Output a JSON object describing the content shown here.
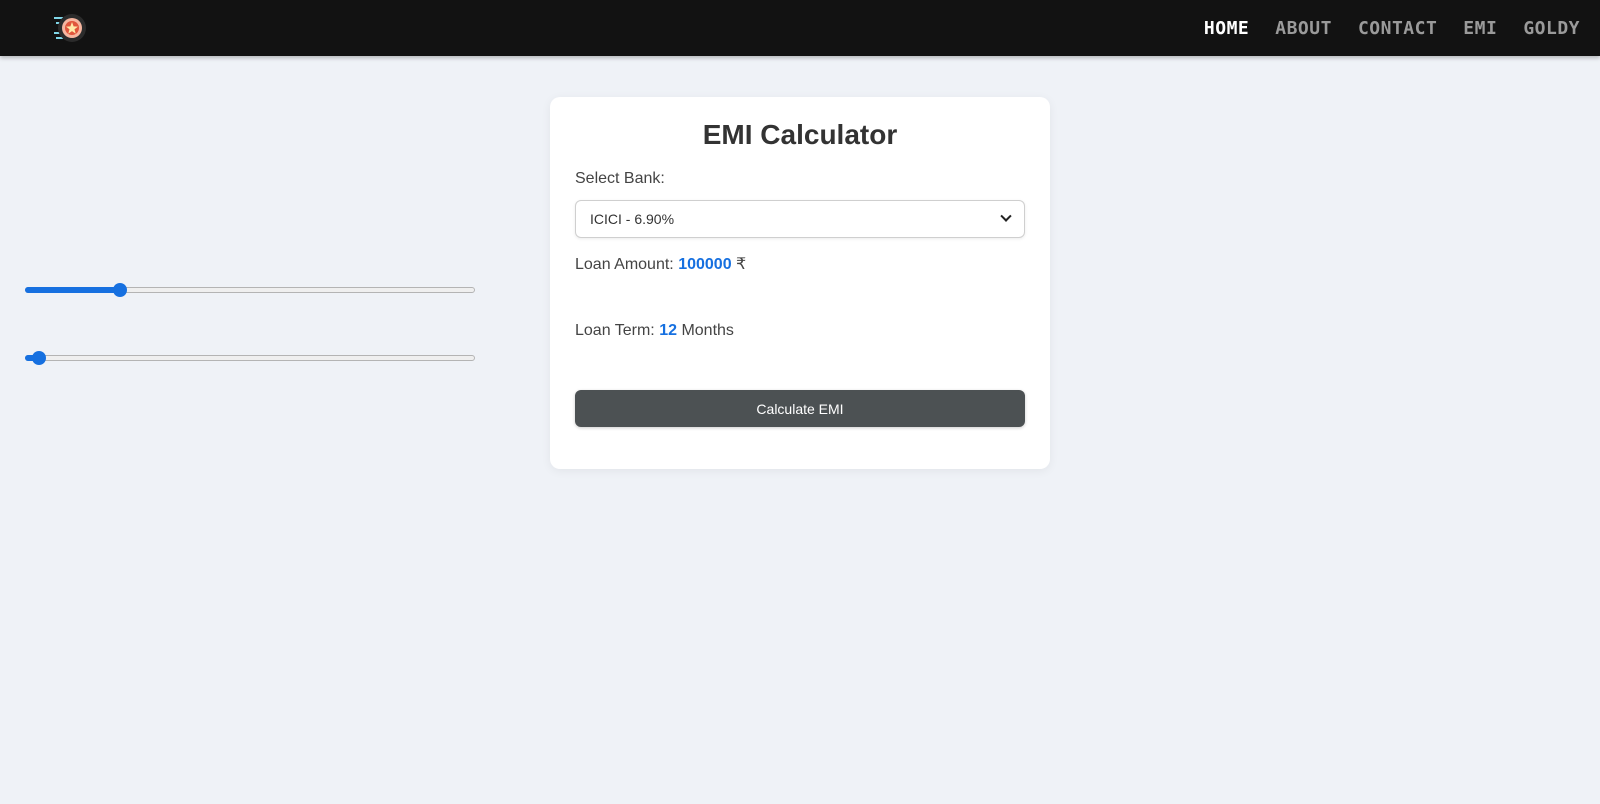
{
  "nav": {
    "logo_icon": "rocket-badge-icon",
    "links": [
      {
        "label": "HOME",
        "active": true
      },
      {
        "label": "ABOUT",
        "active": false
      },
      {
        "label": "CONTACT",
        "active": false
      },
      {
        "label": "EMI",
        "active": false
      },
      {
        "label": "GOLDY",
        "active": false
      }
    ]
  },
  "calculator": {
    "title": "EMI Calculator",
    "bank_label": "Select Bank:",
    "bank_selected": "ICICI - 6.90%",
    "amount_label": "Loan Amount:",
    "amount_value": "100000",
    "amount_unit": "₹",
    "amount_fraction": 0.21,
    "term_label": "Loan Term:",
    "term_value": "12",
    "term_unit": "Months",
    "term_fraction": 0.03,
    "button_label": "Calculate EMI"
  },
  "colors": {
    "accent": "#1670e0",
    "navbar": "#121212",
    "button": "#4c5153",
    "background": "#eff2f7"
  }
}
